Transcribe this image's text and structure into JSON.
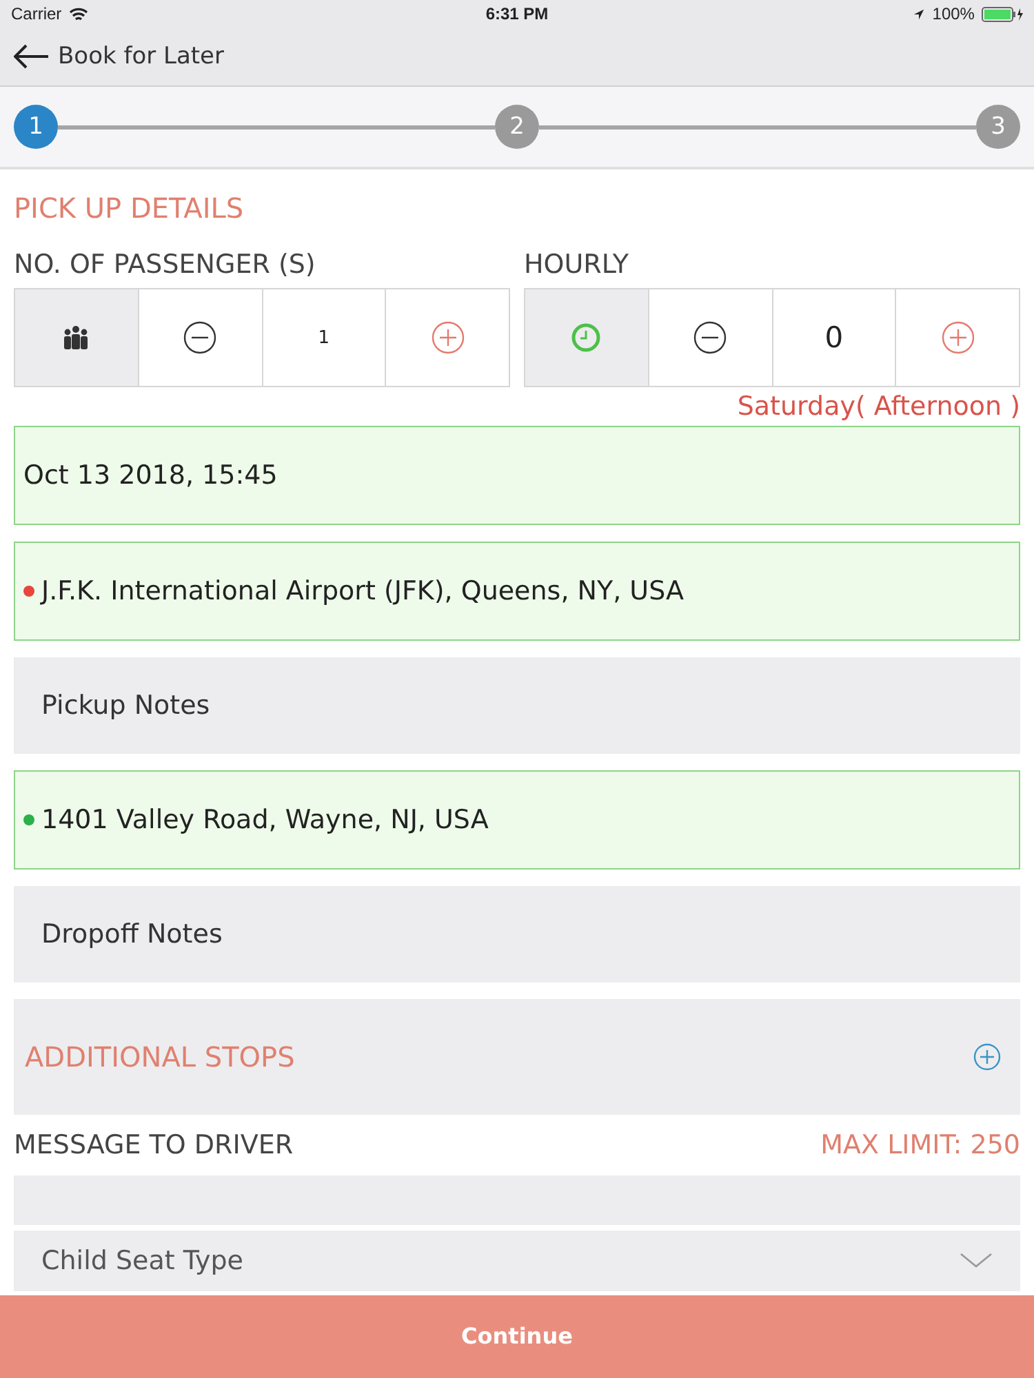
{
  "status_bar": {
    "carrier": "Carrier",
    "time": "6:31 PM",
    "battery": "100%"
  },
  "nav": {
    "title": "Book for Later"
  },
  "steps": [
    {
      "label": "1",
      "selected": true
    },
    {
      "label": "2",
      "selected": false
    },
    {
      "label": "3",
      "selected": false
    }
  ],
  "section_title": "PICK UP DETAILS",
  "counters": [
    {
      "label": "NO. OF PASSENGER (S)",
      "kind": "people",
      "value": "1"
    },
    {
      "label": "HOURLY",
      "kind": "clock",
      "value": "0"
    }
  ],
  "day_note": "Saturday( Afternoon )",
  "fields": [
    {
      "kind": "filled",
      "value": "Oct 13 2018, 15:45"
    },
    {
      "kind": "pickup",
      "value": "J.F.K. International Airport (JFK), Queens, NY, USA",
      "color": "#e8453c"
    },
    {
      "kind": "empty",
      "placeholder": "Pickup Notes"
    },
    {
      "kind": "dropoff",
      "value": "1401 Valley Road, Wayne, NJ, USA",
      "color": "#2bb04a"
    },
    {
      "kind": "empty",
      "placeholder": "Dropoff Notes"
    }
  ],
  "additional_stops": "ADDITIONAL STOPS",
  "message": {
    "label": "MESSAGE TO DRIVER",
    "limit": "MAX LIMIT: 250"
  },
  "child_seat": {
    "placeholder": "Child Seat Type"
  },
  "continue_button": "Continue"
}
